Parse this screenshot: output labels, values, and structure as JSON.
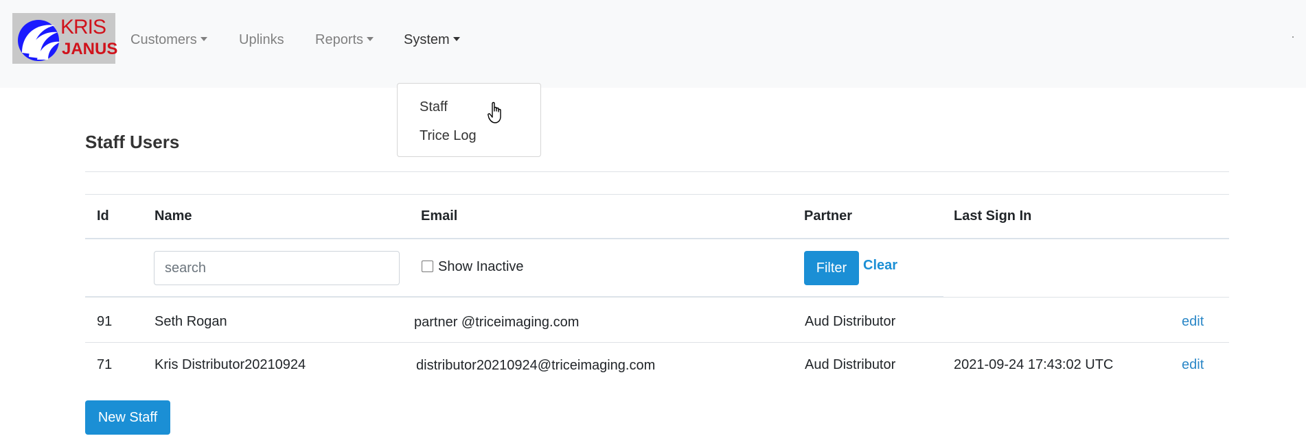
{
  "brand": {
    "logo_line1": "KRIS",
    "logo_line2": "JANUS"
  },
  "nav": {
    "customers": "Customers",
    "uplinks": "Uplinks",
    "reports": "Reports",
    "system": "System"
  },
  "dropdown": {
    "items": [
      "Staff",
      "Trice Log"
    ]
  },
  "page": {
    "title": "Staff Users"
  },
  "table": {
    "headers": [
      "Id",
      "Name",
      "Email",
      "Partner",
      "Last Sign In"
    ],
    "filters": {
      "search_placeholder": "search",
      "show_inactive": "Show Inactive",
      "filter_button": "Filter",
      "clear_link": "Clear"
    },
    "rows": [
      {
        "id": "91",
        "name": "Seth Rogan",
        "email": "partner @triceimaging.com",
        "partner": "Aud Distributor",
        "last_sign_in": "",
        "action": "edit"
      },
      {
        "id": "71",
        "name": "Kris Distributor20210924",
        "email": "distributor20210924@triceimaging.com",
        "partner": "Aud Distributor",
        "last_sign_in": "2021-09-24 17:43:02 UTC",
        "action": "edit"
      }
    ]
  },
  "actions": {
    "new_staff": "New Staff"
  },
  "colors": {
    "primary": "#1b8fd5",
    "navbar_bg": "#f8f9fa",
    "logo_red": "#d0121b",
    "logo_blue": "#1a1aff"
  }
}
